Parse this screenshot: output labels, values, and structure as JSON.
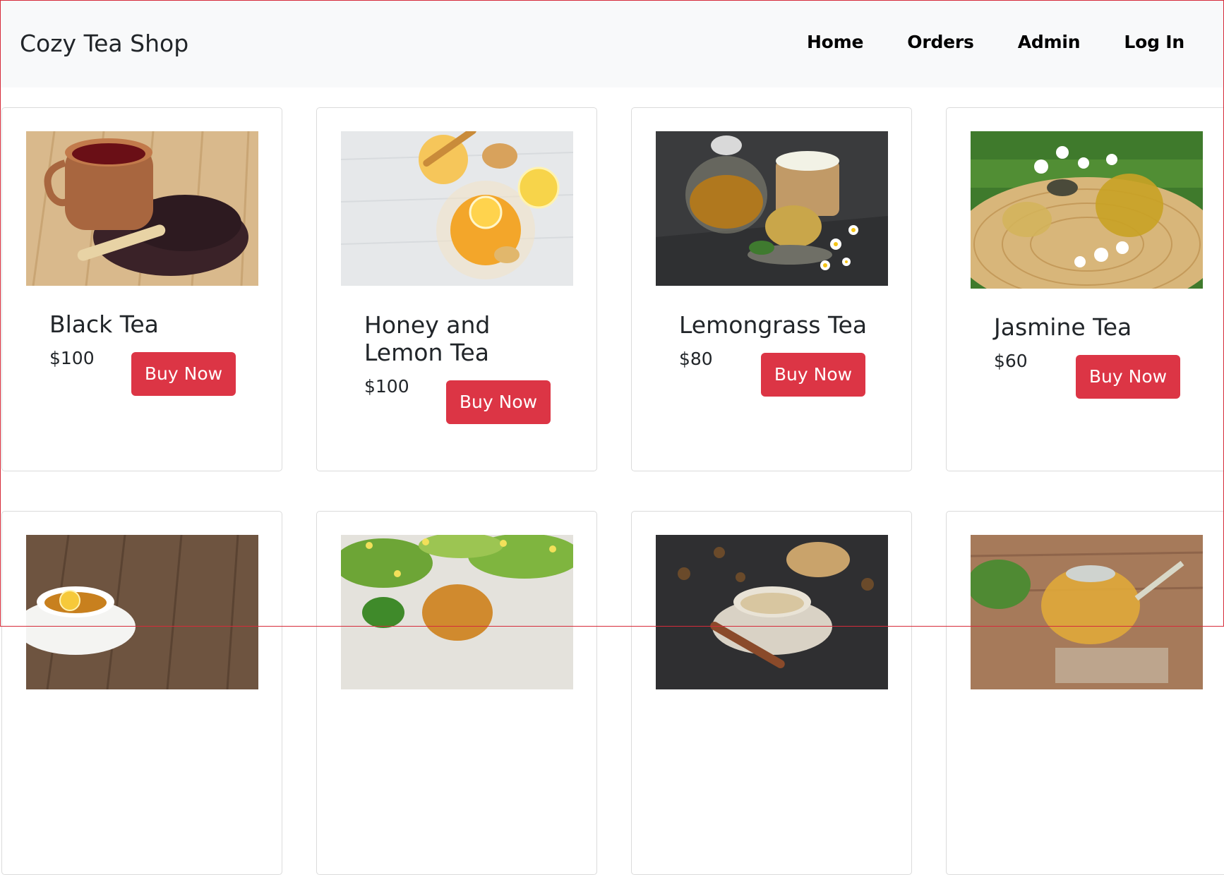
{
  "navbar": {
    "brand": "Cozy Tea Shop",
    "links": [
      "Home",
      "Orders",
      "Admin",
      "Log In"
    ]
  },
  "products": [
    {
      "name": "Black Tea",
      "price": "$100",
      "button": "Buy Now",
      "image": "black-tea-image"
    },
    {
      "name": "Honey and Lemon Tea",
      "price": "$100",
      "button": "Buy Now",
      "image": "honey-lemon-tea-image"
    },
    {
      "name": "Lemongrass Tea",
      "price": "$80",
      "button": "Buy Now",
      "image": "lemongrass-tea-image"
    },
    {
      "name": "Jasmine Tea",
      "price": "$60",
      "button": "Buy Now",
      "image": "jasmine-tea-image"
    },
    {
      "image": "lemon-tea-cup-image"
    },
    {
      "image": "linden-tea-image"
    },
    {
      "image": "chai-tea-image"
    },
    {
      "image": "herbal-teapot-image"
    }
  ],
  "colors": {
    "accent": "#dc3545",
    "navbar_bg": "#f8f9fa",
    "frame": "#d62b3a"
  }
}
